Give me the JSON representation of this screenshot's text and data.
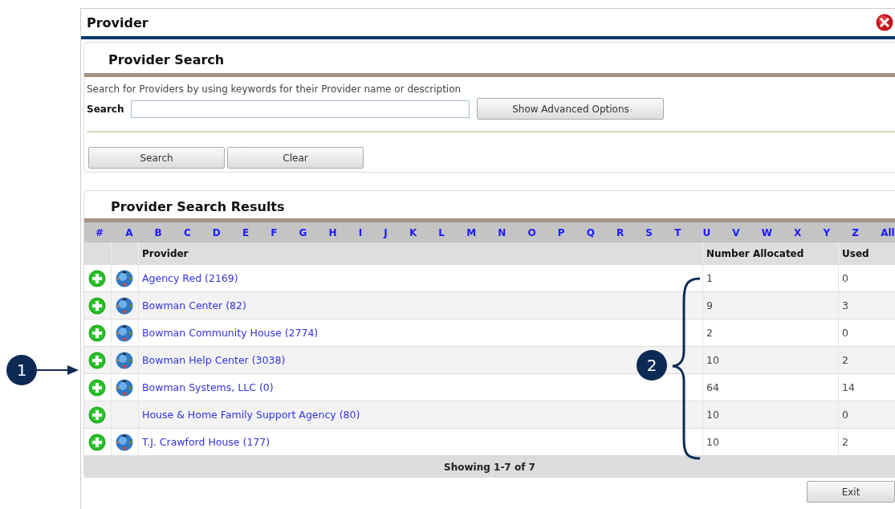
{
  "window": {
    "title": "Provider"
  },
  "search_panel": {
    "title": "Provider Search",
    "description": "Search for Providers by using keywords for their Provider name or description",
    "search_label": "Search",
    "advanced_button": "Show Advanced Options",
    "buttons": [
      "Search",
      "Clear"
    ]
  },
  "results_panel": {
    "title": "Provider Search Results",
    "alphabet": [
      "#",
      "A",
      "B",
      "C",
      "D",
      "E",
      "F",
      "G",
      "H",
      "I",
      "J",
      "K",
      "L",
      "M",
      "N",
      "O",
      "P",
      "Q",
      "R",
      "S",
      "T",
      "U",
      "V",
      "W",
      "X",
      "Y",
      "Z",
      "All"
    ],
    "columns": [
      "Provider",
      "Number Allocated",
      "Used"
    ],
    "rows": [
      {
        "provider": "Agency Red (2169)",
        "allocated": "1",
        "used": "0",
        "globe": true
      },
      {
        "provider": "Bowman Center (82)",
        "allocated": "9",
        "used": "3",
        "globe": true
      },
      {
        "provider": "Bowman Community House (2774)",
        "allocated": "2",
        "used": "0",
        "globe": true
      },
      {
        "provider": "Bowman Help Center (3038)",
        "allocated": "10",
        "used": "2",
        "globe": true
      },
      {
        "provider": "Bowman Systems, LLC (0)",
        "allocated": "64",
        "used": "14",
        "globe": true
      },
      {
        "provider": "House & Home Family Support Agency (80)",
        "allocated": "10",
        "used": "0",
        "globe": false
      },
      {
        "provider": "T.J. Crawford House (177)",
        "allocated": "10",
        "used": "2",
        "globe": true
      }
    ],
    "footer": "Showing 1-7 of 7"
  },
  "exit_button": "Exit",
  "callouts": [
    {
      "label": "1",
      "kind": "arrow"
    },
    {
      "label": "2",
      "kind": "brace"
    }
  ]
}
